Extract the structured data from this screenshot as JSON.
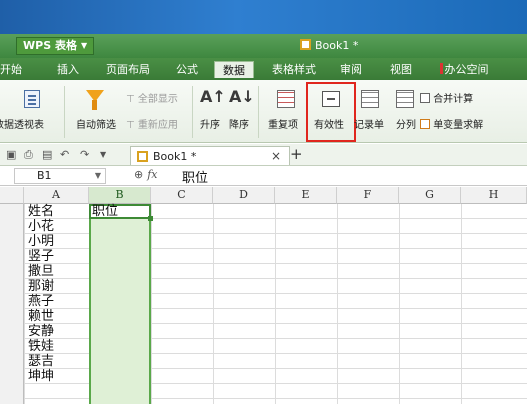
{
  "window": {
    "app_label": "WPS 表格",
    "doc_title": "Book1 *"
  },
  "menu": {
    "tabs": [
      {
        "label": "开始"
      },
      {
        "label": "插入"
      },
      {
        "label": "页面布局"
      },
      {
        "label": "公式"
      },
      {
        "label": "数据"
      },
      {
        "label": "表格样式"
      },
      {
        "label": "审阅"
      },
      {
        "label": "视图"
      },
      {
        "label": "办公空间"
      }
    ],
    "active_tab": "数据"
  },
  "ribbon": {
    "pivot_label": "数据透视表",
    "autofilter_label": "自动筛选",
    "show_all_label": "全部显示",
    "reapply_label": "重新应用",
    "sort_asc_label": "升序",
    "sort_desc_label": "降序",
    "duplicates_label": "重复项",
    "validity_label": "有效性",
    "record_label": "记录单",
    "split_label": "分列",
    "consolidate_label": "合并计算",
    "solver_label": "单变量求解",
    "highlight_color": "#e0261e"
  },
  "tabs_bar": {
    "doc_tab_label": "Book1 *",
    "close_glyph": "×",
    "new_tab_glyph": "+"
  },
  "formula_bar": {
    "name_box": "B1",
    "fx_label": "fx",
    "value": "职位"
  },
  "sheet": {
    "columns": [
      "A",
      "B",
      "C",
      "D",
      "E",
      "F",
      "G",
      "H"
    ],
    "selected_column": "B",
    "column_a_values": [
      "姓名",
      "小花",
      "小明",
      "竖子",
      "撒旦",
      "那谢",
      "燕子",
      "赖世",
      "安静",
      "铁娃",
      "瑟吉",
      "坤坤"
    ],
    "b1_value": "职位",
    "selection_color": "#dff0d6"
  }
}
